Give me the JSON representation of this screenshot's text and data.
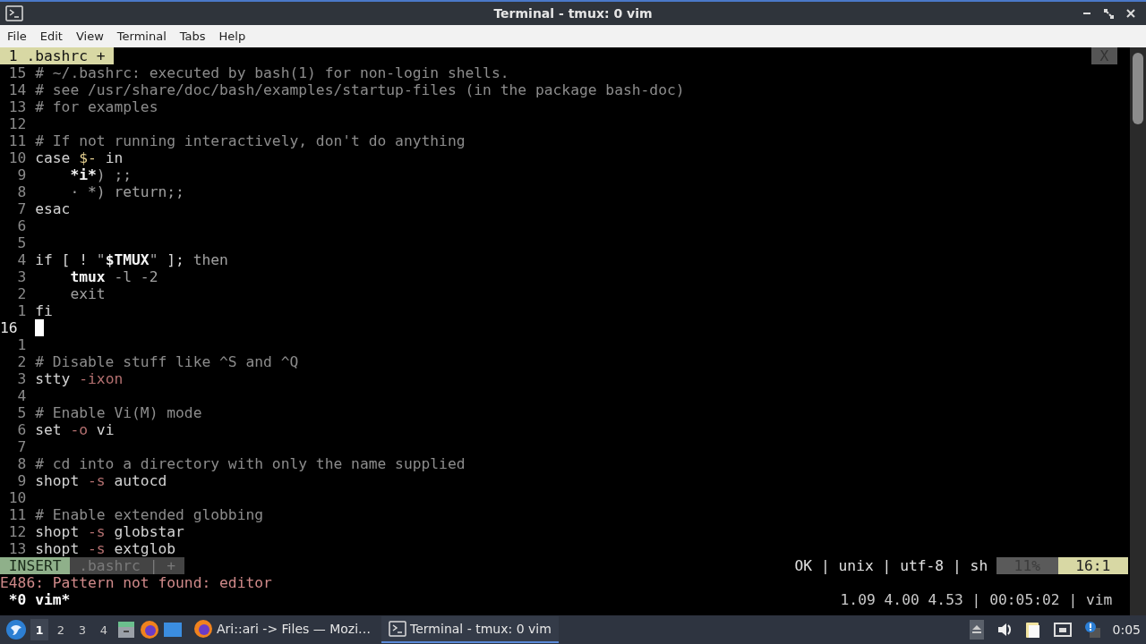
{
  "window": {
    "title": "Terminal - tmux: 0 vim",
    "menu": [
      "File",
      "Edit",
      "View",
      "Terminal",
      "Tabs",
      "Help"
    ]
  },
  "vim": {
    "tabs": [
      {
        "label": "1 .bashrc +",
        "selected": true
      }
    ],
    "close_label": "X",
    "lines": [
      {
        "number": "15",
        "current": false,
        "segments": [
          {
            "kind": "comment",
            "text": "# ~/.bashrc: executed by bash(1) for non-login shells."
          }
        ]
      },
      {
        "number": "14",
        "current": false,
        "segments": [
          {
            "kind": "comment",
            "text": "# see /usr/share/doc/bash/examples/startup-files (in the package bash-doc)"
          }
        ]
      },
      {
        "number": "13",
        "current": false,
        "segments": [
          {
            "kind": "comment",
            "text": "# for examples"
          }
        ]
      },
      {
        "number": "12",
        "current": false
      },
      {
        "number": "11",
        "current": false,
        "segments": [
          {
            "kind": "comment",
            "text": "# If not running interactively, don't do anything"
          }
        ]
      },
      {
        "number": "10",
        "current": false,
        "segments": [
          {
            "kind": "text",
            "text": "case "
          },
          {
            "kind": "var",
            "text": "$-"
          },
          {
            "kind": "text",
            "text": " in"
          }
        ]
      },
      {
        "number": "9",
        "current": false,
        "segments": [
          {
            "kind": "bright",
            "text": "    *i*"
          },
          {
            "kind": "dim",
            "text": ") ;;"
          }
        ]
      },
      {
        "number": "8",
        "current": false,
        "segments": [
          {
            "kind": "dim",
            "text": "    · *) return;;"
          }
        ]
      },
      {
        "number": "7",
        "current": false,
        "segments": [
          {
            "kind": "text",
            "text": "esac"
          }
        ]
      },
      {
        "number": "6",
        "current": false
      },
      {
        "number": "5",
        "current": false
      },
      {
        "number": "4",
        "current": false,
        "segments": [
          {
            "kind": "text",
            "text": "if [ ! "
          },
          {
            "kind": "dim",
            "text": "\""
          },
          {
            "kind": "bright",
            "text": "$TMUX"
          },
          {
            "kind": "dim",
            "text": "\""
          },
          {
            "kind": "text",
            "text": " ]; "
          },
          {
            "kind": "dim",
            "text": "then"
          }
        ]
      },
      {
        "number": "3",
        "current": false,
        "segments": [
          {
            "kind": "bright",
            "text": "    tmux"
          },
          {
            "kind": "dim",
            "text": " -l -2"
          }
        ]
      },
      {
        "number": "2",
        "current": false,
        "segments": [
          {
            "kind": "dim",
            "text": "    exit"
          }
        ]
      },
      {
        "number": "1",
        "current": false,
        "segments": [
          {
            "kind": "text",
            "text": "fi"
          }
        ]
      },
      {
        "number": "16",
        "current": true
      },
      {
        "number": "1",
        "current": false
      },
      {
        "number": "2",
        "current": false,
        "segments": [
          {
            "kind": "comment",
            "text": "# Disable stuff like ^S and ^Q"
          }
        ]
      },
      {
        "number": "3",
        "current": false,
        "segments": [
          {
            "kind": "text",
            "text": "stty "
          },
          {
            "kind": "option",
            "text": "-ixon"
          }
        ]
      },
      {
        "number": "4",
        "current": false
      },
      {
        "number": "5",
        "current": false,
        "segments": [
          {
            "kind": "comment",
            "text": "# Enable Vi(M) mode"
          }
        ]
      },
      {
        "number": "6",
        "current": false,
        "segments": [
          {
            "kind": "text",
            "text": "set "
          },
          {
            "kind": "option",
            "text": "-o"
          },
          {
            "kind": "text",
            "text": " vi"
          }
        ]
      },
      {
        "number": "7",
        "current": false
      },
      {
        "number": "8",
        "current": false,
        "segments": [
          {
            "kind": "comment",
            "text": "# cd into a directory with only the name supplied"
          }
        ]
      },
      {
        "number": "9",
        "current": false,
        "segments": [
          {
            "kind": "text",
            "text": "shopt "
          },
          {
            "kind": "option",
            "text": "-s"
          },
          {
            "kind": "text",
            "text": " autocd"
          }
        ]
      },
      {
        "number": "10",
        "current": false
      },
      {
        "number": "11",
        "current": false,
        "segments": [
          {
            "kind": "comment",
            "text": "# Enable extended globbing"
          }
        ]
      },
      {
        "number": "12",
        "current": false,
        "segments": [
          {
            "kind": "text",
            "text": "shopt "
          },
          {
            "kind": "option",
            "text": "-s"
          },
          {
            "kind": "text",
            "text": " globstar"
          }
        ]
      },
      {
        "number": "13",
        "current": false,
        "segments": [
          {
            "kind": "text",
            "text": "shopt "
          },
          {
            "kind": "option",
            "text": "-s"
          },
          {
            "kind": "text",
            "text": " extglob"
          }
        ]
      }
    ],
    "statusline": {
      "left": [
        {
          "kind": "mode",
          "text": "INSERT"
        },
        {
          "kind": "file",
          "text": ".bashrc | +"
        }
      ],
      "right": [
        {
          "kind": "info",
          "text": "OK | unix | utf-8 | sh"
        },
        {
          "kind": "percent",
          "text": "11%"
        },
        {
          "kind": "position",
          "text": "16:1"
        }
      ]
    },
    "message": "E486: Pattern not found: editor"
  },
  "tmux": {
    "window": "*0 vim*",
    "status": "1.09 4.00 4.53 | 00:05:02 | vim"
  },
  "taskbar": {
    "workspaces": [
      {
        "label": "1",
        "selected": true
      },
      {
        "label": "2",
        "selected": false
      },
      {
        "label": "3",
        "selected": false
      },
      {
        "label": "4",
        "selected": false
      }
    ],
    "tasks": [
      {
        "label": "Ari::ari -> Files — Mozi…",
        "kind": "browser",
        "selected": false
      },
      {
        "label": "Terminal - tmux: 0 vim",
        "kind": "terminal",
        "selected": true
      }
    ],
    "clock": "0:05"
  }
}
